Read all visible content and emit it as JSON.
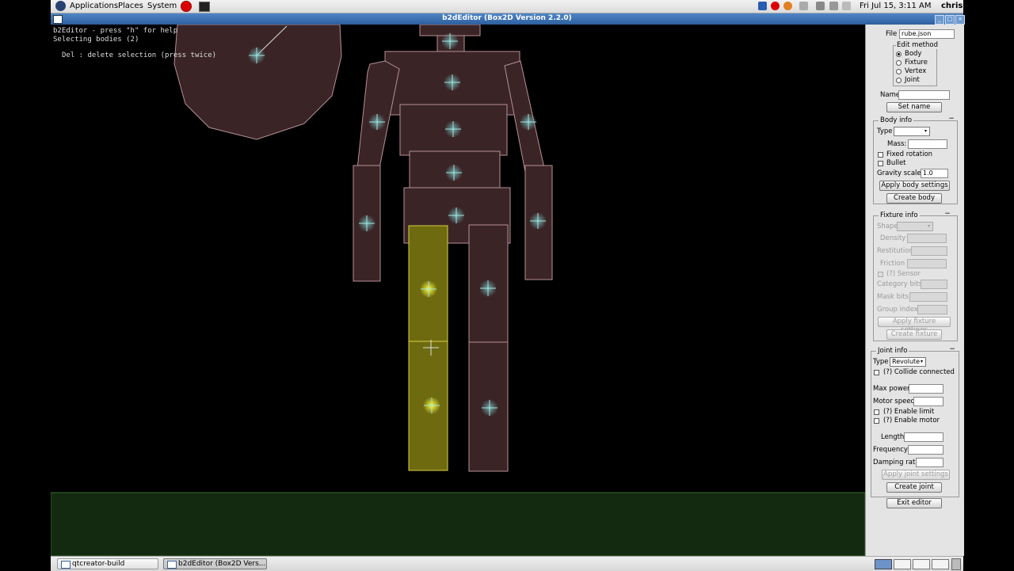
{
  "top_panel": {
    "menus": [
      "Applications",
      "Places",
      "System"
    ],
    "clock": "Fri Jul 15,  3:11 AM",
    "user": "chris"
  },
  "window": {
    "title": "b2dEditor (Box2D Version 2.2.0)",
    "buttons": [
      "_",
      "□",
      "×"
    ]
  },
  "console": {
    "line1": "b2Editor - press \"h\" for help",
    "line2": "Selecting bodies (2)",
    "line3": "Del : delete selection (press twice)"
  },
  "panel": {
    "file_label": "File",
    "file_value": "rube.json",
    "edit_method": {
      "title": "Edit method",
      "options": [
        "Body",
        "Fixture",
        "Vertex",
        "Joint"
      ],
      "selected": "Body"
    },
    "name_label": "Name",
    "name_value": "",
    "set_name": "Set name",
    "body_info": {
      "title": "Body info",
      "collapse": "−",
      "type_label": "Type",
      "type_value": "",
      "mass_label": "Mass:",
      "fixed_rotation": "Fixed rotation",
      "bullet": "Bullet",
      "gravity_label": "Gravity scale:",
      "gravity_value": "1.0",
      "apply": "Apply body settings",
      "create": "Create body"
    },
    "fixture_info": {
      "title": "Fixture info",
      "collapse": "−",
      "shape": "Shape",
      "density": "Density",
      "restitution": "Restitution",
      "friction": "Friction",
      "sensor": "(?) Sensor",
      "category": "Category bits",
      "mask": "Mask bits",
      "group": "Group index",
      "apply": "Apply fixture settings",
      "create": "Create fixture"
    },
    "joint_info": {
      "title": "Joint info",
      "collapse": "−",
      "type_label": "Type",
      "type_value": "Revolute",
      "collide": "(?) Collide connected",
      "max_power": "Max power",
      "motor_speed": "Motor speed",
      "enable_limit": "(?) Enable limit",
      "enable_motor": "(?) Enable motor",
      "length": "Length",
      "frequency": "Frequency",
      "damping": "Damping ratio",
      "apply": "Apply joint settings",
      "create": "Create joint"
    },
    "exit": "Exit editor"
  },
  "taskbar": {
    "tasks": [
      "qtcreator-build",
      "b2dEditor (Box2D Vers..."
    ]
  },
  "colors": {
    "body_fill": "#3a2426",
    "body_stroke": "#b89096",
    "selected_fill": "#6e6a10",
    "selected_stroke": "#d8d040",
    "ground": "#142a10",
    "panel_bg": "#e4e4e4",
    "title_blue": "#3a6eb0"
  }
}
